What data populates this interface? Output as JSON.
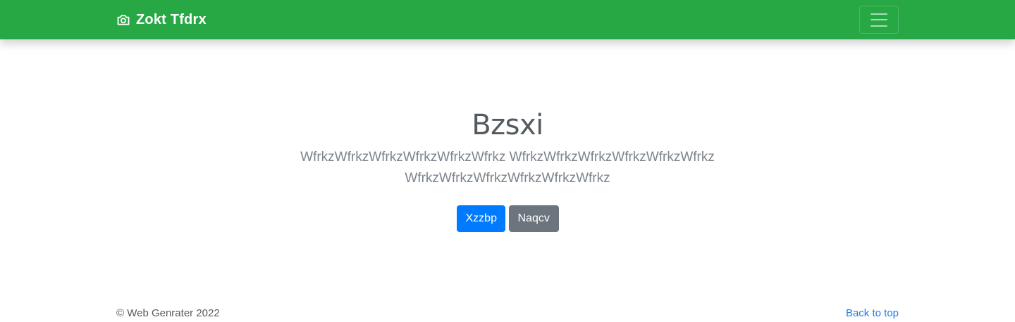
{
  "navbar": {
    "brand_label": "Zokt Tfdrx",
    "brand_icon": "camera-icon",
    "toggler_icon": "hamburger-menu-icon",
    "background_color": "#28a745"
  },
  "hero": {
    "title": "Bzsxi",
    "lead": "WfrkzWfrkzWfrkzWfrkzWfrkzWfrkz WfrkzWfrkzWfrkzWfrkzWfrkzWfrkz WfrkzWfrkzWfrkzWfrkzWfrkzWfrkz",
    "primary_button_label": "Xzzbp",
    "secondary_button_label": "Naqcv",
    "primary_color": "#007bff",
    "secondary_color": "#6c757d"
  },
  "footer": {
    "copyright": "© Web Genrater 2022",
    "back_to_top_label": "Back to top",
    "link_color": "#007bff"
  }
}
